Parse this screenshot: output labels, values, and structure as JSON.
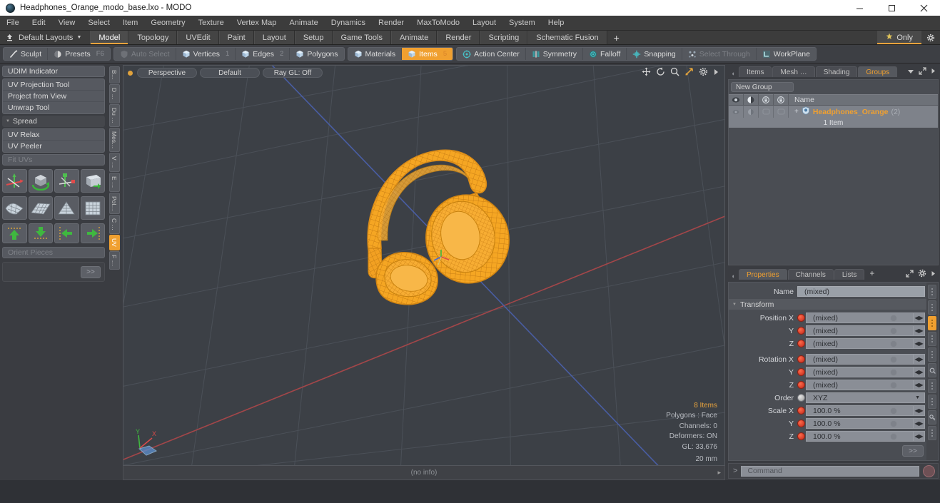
{
  "titlebar": {
    "title": "Headphones_Orange_modo_base.lxo - MODO",
    "minimize": "minimize-icon",
    "maximize": "maximize-icon",
    "close": "close-icon"
  },
  "menubar": {
    "items": [
      "File",
      "Edit",
      "View",
      "Select",
      "Item",
      "Geometry",
      "Texture",
      "Vertex Map",
      "Animate",
      "Dynamics",
      "Render",
      "MaxToModo",
      "Layout",
      "System",
      "Help"
    ]
  },
  "layoutbar": {
    "layouts_label": "Default Layouts",
    "tabs": [
      "Model",
      "Topology",
      "UVEdit",
      "Paint",
      "Layout",
      "Setup",
      "Game Tools",
      "Animate",
      "Render",
      "Scripting",
      "Schematic Fusion"
    ],
    "active_tab": "Model",
    "plus_label": "+",
    "only_label": "Only",
    "star_icon": "star-icon",
    "gear_icon": "gear-icon"
  },
  "modebar": {
    "left_group": [
      {
        "label": "Sculpt",
        "icon": "brush-icon",
        "count": "",
        "state": "normal"
      },
      {
        "label": "Presets",
        "icon": "sphere-icon",
        "count": "F6",
        "state": "normal"
      }
    ],
    "select_group": [
      {
        "label": "Auto Select",
        "icon": "shield-icon",
        "count": "",
        "state": "dim"
      },
      {
        "label": "Vertices",
        "icon": "cube-icon",
        "count": "1",
        "state": "normal"
      },
      {
        "label": "Edges",
        "icon": "cube-icon",
        "count": "2",
        "state": "normal"
      },
      {
        "label": "Polygons",
        "icon": "cube-icon",
        "count": "",
        "state": "normal"
      }
    ],
    "items_group": [
      {
        "label": "Materials",
        "icon": "cube-icon",
        "count": "",
        "state": "normal"
      },
      {
        "label": "Items",
        "icon": "cube-icon",
        "count": "5",
        "state": "active"
      }
    ],
    "right_group": [
      {
        "label": "Action Center",
        "icon": "target-icon",
        "count": "",
        "state": "normal"
      },
      {
        "label": "Symmetry",
        "icon": "symmetry-icon",
        "count": "",
        "state": "normal"
      },
      {
        "label": "Falloff",
        "icon": "falloff-icon",
        "count": "",
        "state": "normal"
      },
      {
        "label": "Snapping",
        "icon": "snap-icon",
        "count": "",
        "state": "normal"
      },
      {
        "label": "Select Through",
        "icon": "selectthrough-icon",
        "count": "",
        "state": "dim"
      },
      {
        "label": "WorkPlane",
        "icon": "workplane-icon",
        "count": "",
        "state": "normal"
      }
    ]
  },
  "leftpanel": {
    "udim_indicator": "UDIM Indicator",
    "uv_tools": [
      "UV Projection Tool",
      "Project from View",
      "Unwrap Tool"
    ],
    "spread_label": "Spread",
    "relax_tools": [
      "UV Relax",
      "UV Peeler"
    ],
    "fit_uvs": "Fit UVs",
    "orient_pieces": "Orient Pieces",
    "more_label": ">>",
    "icon_row_1": [
      "uv-projection-gizmo-icon",
      "cube-rotate-icon",
      "uv-axis-icon",
      "uv-box-icon"
    ],
    "icon_row_2": [
      "uv-sphere-unwrap-icon",
      "uv-grid-flat-icon",
      "uv-cone-icon",
      "uv-grid-box-icon"
    ],
    "arrow_row": [
      "arrow-up-icon",
      "arrow-down-icon",
      "arrow-left-icon",
      "arrow-right-icon"
    ],
    "vertical_tabs": [
      {
        "label": "B…",
        "active": false
      },
      {
        "label": "D …",
        "active": false
      },
      {
        "label": "Du …",
        "active": false
      },
      {
        "label": "Mes…",
        "active": false
      },
      {
        "label": "V …",
        "active": false
      },
      {
        "label": "E …",
        "active": false
      },
      {
        "label": "Pol…",
        "active": false
      },
      {
        "label": "C …",
        "active": false
      },
      {
        "label": "UV",
        "active": true
      },
      {
        "label": "F …",
        "active": false
      }
    ]
  },
  "viewport": {
    "view_mode": "Perspective",
    "shading": "Default",
    "raygl": "Ray GL: Off",
    "nav_icons": [
      "pan-icon",
      "rotate-icon",
      "zoom-icon",
      "fit-icon",
      "gear-icon",
      "chevron-right-icon"
    ],
    "stats": {
      "items": "8 Items",
      "polygons": "Polygons : Face",
      "channels": "Channels: 0",
      "deformers": "Deformers: ON",
      "gl": "GL: 33,676"
    },
    "unit": "20 mm",
    "gizmo_axes": [
      "Y",
      "X"
    ],
    "status": "(no info)",
    "model": "orange-headphones-wireframe"
  },
  "grouppanel": {
    "tabs": [
      {
        "label": "Items",
        "active": false
      },
      {
        "label": "Mesh …",
        "active": false
      },
      {
        "label": "Shading",
        "active": false
      },
      {
        "label": "Groups",
        "active": true
      }
    ],
    "dropdown_icon": "chevron-down-icon",
    "expand_icon": "expand-icon",
    "arrow_icon": "chevron-right-icon",
    "new_group_button": "New Group",
    "column_icons": [
      "eye-icon",
      "render-icon",
      "lock-icon",
      "lock-alt-icon"
    ],
    "name_header": "Name",
    "rows": [
      {
        "name": "Headphones_Orange",
        "count": "(2)",
        "sub": "1 Item",
        "icon": "group-icon"
      }
    ]
  },
  "properties": {
    "tabs": [
      {
        "label": "Properties",
        "active": true
      },
      {
        "label": "Channels",
        "active": false
      },
      {
        "label": "Lists",
        "active": false
      },
      {
        "label": "+",
        "active": false
      }
    ],
    "expand_icon": "expand-icon",
    "gear_icon": "gear-icon",
    "arrow_icon": "chevron-right-icon",
    "name_label": "Name",
    "name_value": "(mixed)",
    "transform_label": "Transform",
    "fields": [
      {
        "label": "Position X",
        "value": "(mixed)",
        "type": "num"
      },
      {
        "label": "Y",
        "value": "(mixed)",
        "type": "num"
      },
      {
        "label": "Z",
        "value": "(mixed)",
        "type": "num"
      },
      {
        "label": "Rotation X",
        "value": "(mixed)",
        "type": "num"
      },
      {
        "label": "Y",
        "value": "(mixed)",
        "type": "num"
      },
      {
        "label": "Z",
        "value": "(mixed)",
        "type": "num"
      },
      {
        "label": "Order",
        "value": "XYZ",
        "type": "select"
      },
      {
        "label": "Scale X",
        "value": "100.0 %",
        "type": "num"
      },
      {
        "label": "Y",
        "value": "100.0 %",
        "type": "num"
      },
      {
        "label": "Z",
        "value": "100.0 %",
        "type": "num"
      }
    ],
    "more_label": ">>",
    "side_tabs": [
      "dots",
      "dots",
      "dots-active",
      "dots",
      "dots",
      "search-icon",
      "dots",
      "dots",
      "key-icon",
      "dots"
    ]
  },
  "commandbar": {
    "prompt": ">",
    "placeholder": "Command",
    "record_button": "record-icon"
  },
  "colors": {
    "accent": "#f0a030",
    "panel": "#4a4d53",
    "chrome": "#3a3c41",
    "viewport_bg": "#3c4046",
    "model": "#f5a623"
  }
}
